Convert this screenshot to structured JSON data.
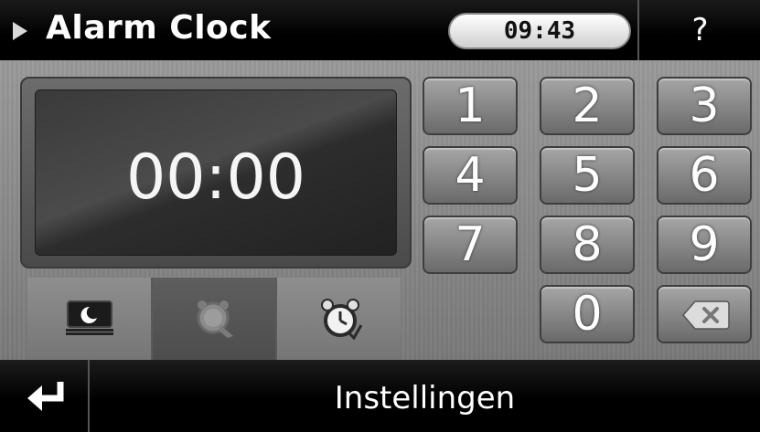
{
  "header": {
    "title": "Alarm Clock",
    "time": "09:43",
    "help_label": "?"
  },
  "display": {
    "time": "00:00"
  },
  "modes": [
    {
      "name": "sleep-mode-icon",
      "active": false
    },
    {
      "name": "snooze-icon",
      "active": true
    },
    {
      "name": "alarm-clock-icon",
      "active": false
    }
  ],
  "keypad": {
    "keys": [
      "1",
      "2",
      "3",
      "4",
      "5",
      "6",
      "7",
      "8",
      "9",
      "0"
    ],
    "backspace_icon": "backspace-icon"
  },
  "footer": {
    "back_icon": "return-arrow-icon",
    "label": "Instellingen"
  }
}
